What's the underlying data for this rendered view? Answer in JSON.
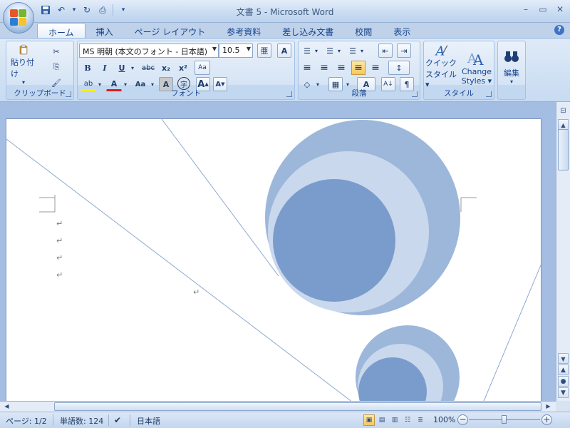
{
  "window": {
    "title": "文書 5 - Microsoft Word",
    "controls": {
      "minimize": "–",
      "restore": "▭",
      "close": "✕"
    }
  },
  "qat": {
    "save_icon": "💾",
    "undo_icon": "↶",
    "undo_dropdown": "▾",
    "redo_icon": "↻",
    "print_icon": "⎙",
    "customize": "▾"
  },
  "tabs": [
    "ホーム",
    "挿入",
    "ページ レイアウト",
    "参考資料",
    "差し込み文書",
    "校閲",
    "表示"
  ],
  "active_tab": 0,
  "help": "?",
  "ribbon": {
    "clipboard": {
      "label": "クリップボード",
      "paste_label": "貼り付け",
      "paste_dropdown": "▾",
      "cut_icon": "✂",
      "copy_icon": "⎘",
      "format_painter_icon": "🖌"
    },
    "font": {
      "label": "フォント",
      "font_name": "MS 明朝 (本文のフォント - 日本語)",
      "font_size": "10.5",
      "bold": "B",
      "italic": "I",
      "underline": "U",
      "strike": "abc",
      "subscript": "x₂",
      "superscript": "x²",
      "highlight": "ab",
      "font_color": "A",
      "case": "Aa",
      "char_shading": "A",
      "enclose": "字",
      "grow": "A",
      "shrink": "A",
      "phonetic": "亜",
      "border": "A",
      "clear": "Aa"
    },
    "paragraph": {
      "label": "段落",
      "bullets": "☰",
      "numbering": "☰",
      "multilevel": "☰",
      "decrease_indent": "⇤",
      "increase_indent": "⇥",
      "align_left": "≡",
      "align_center": "≡",
      "align_right": "≡",
      "justify": "≡",
      "distributed": "≡",
      "line_spacing": "↕",
      "shading": "◇",
      "borders": "▦",
      "asian_layout": "A",
      "sort": "A↓",
      "show_marks": "¶"
    },
    "styles": {
      "label": "スタイル",
      "quick_styles_line1": "クイック",
      "quick_styles_line2": "スタイル",
      "change_styles_line1": "Change",
      "change_styles_line2": "Styles"
    },
    "editing": {
      "label": "編集"
    }
  },
  "document": {
    "paragraph_mark": "↵"
  },
  "statusbar": {
    "page": "ページ: 1/2",
    "words": "単語数: 124",
    "language": "日本語",
    "zoom": "100%",
    "zoom_out": "−",
    "zoom_in": "+"
  }
}
